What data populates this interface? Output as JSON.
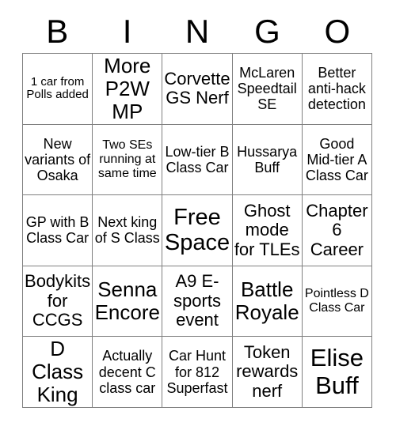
{
  "card": {
    "title": "BINGO",
    "header_letters": [
      "B",
      "I",
      "N",
      "G",
      "O"
    ],
    "grid_columns": 5,
    "grid_rows": 5,
    "border_color": "#808080",
    "background_color": "#ffffff",
    "text_color": "#000000",
    "cells": [
      {
        "text": "1 car from Polls added",
        "size": "xs",
        "row": 1,
        "column": "B"
      },
      {
        "text": "More P2W MP",
        "size": "xl",
        "row": 1,
        "column": "I"
      },
      {
        "text": "Corvette GS Nerf",
        "size": "lg",
        "row": 1,
        "column": "N"
      },
      {
        "text": "McLaren Speedtail SE",
        "size": "md",
        "row": 1,
        "column": "G"
      },
      {
        "text": "Better anti-hack detection",
        "size": "md",
        "row": 1,
        "column": "O"
      },
      {
        "text": "New variants of Osaka",
        "size": "md",
        "row": 2,
        "column": "B"
      },
      {
        "text": "Two SEs running at same time",
        "size": "sm",
        "row": 2,
        "column": "I"
      },
      {
        "text": "Low-tier B Class Car",
        "size": "md",
        "row": 2,
        "column": "N"
      },
      {
        "text": "Hussarya Buff",
        "size": "md",
        "row": 2,
        "column": "G"
      },
      {
        "text": "Good Mid-tier A Class Car",
        "size": "md",
        "row": 2,
        "column": "O"
      },
      {
        "text": "GP with B Class Car",
        "size": "md",
        "row": 3,
        "column": "B"
      },
      {
        "text": "Next king of S Class",
        "size": "md",
        "row": 3,
        "column": "I"
      },
      {
        "text": "Free Space",
        "size": "xxl",
        "row": 3,
        "column": "N"
      },
      {
        "text": "Ghost mode for TLEs",
        "size": "lg",
        "row": 3,
        "column": "G"
      },
      {
        "text": "Chapter 6 Career",
        "size": "lg",
        "row": 3,
        "column": "O"
      },
      {
        "text": "Bodykits for CCGS",
        "size": "lg",
        "row": 4,
        "column": "B"
      },
      {
        "text": "Senna Encore",
        "size": "xl",
        "row": 4,
        "column": "I"
      },
      {
        "text": "A9 E-sports event",
        "size": "lg",
        "row": 4,
        "column": "N"
      },
      {
        "text": "Battle Royale",
        "size": "xl",
        "row": 4,
        "column": "G"
      },
      {
        "text": "Pointless D Class Car",
        "size": "sm",
        "row": 4,
        "column": "O"
      },
      {
        "text": "D Class King",
        "size": "xl",
        "row": 5,
        "column": "B"
      },
      {
        "text": "Actually decent C class car",
        "size": "md",
        "row": 5,
        "column": "I"
      },
      {
        "text": "Car Hunt for 812 Superfast",
        "size": "md",
        "row": 5,
        "column": "N"
      },
      {
        "text": "Token rewards nerf",
        "size": "lg",
        "row": 5,
        "column": "G"
      },
      {
        "text": "Elise Buff",
        "size": "xxl",
        "row": 5,
        "column": "O"
      }
    ]
  }
}
